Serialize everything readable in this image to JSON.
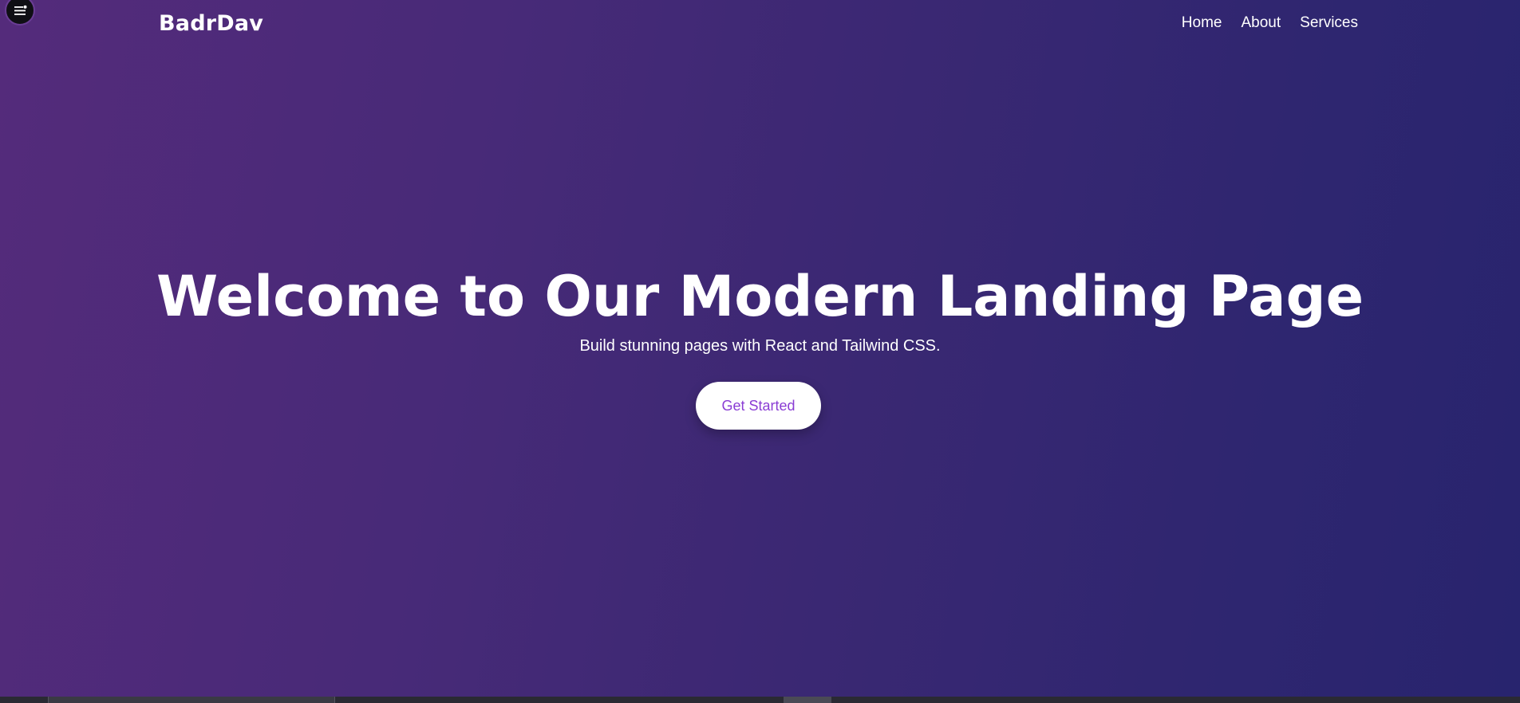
{
  "header": {
    "brand": "BadrDav",
    "nav": [
      {
        "label": "Home"
      },
      {
        "label": "About"
      },
      {
        "label": "Services"
      }
    ]
  },
  "hero": {
    "title": "Welcome to Our Modern Landing Page",
    "subtitle": "Build stunning pages with React and Tailwind CSS.",
    "cta_label": "Get Started"
  },
  "icons": {
    "menu_button": "menu-icon"
  },
  "colors": {
    "gradient_left": "#542b7b",
    "gradient_right": "#28246e",
    "cta_text": "#8a3dd4",
    "text": "#ffffff"
  }
}
